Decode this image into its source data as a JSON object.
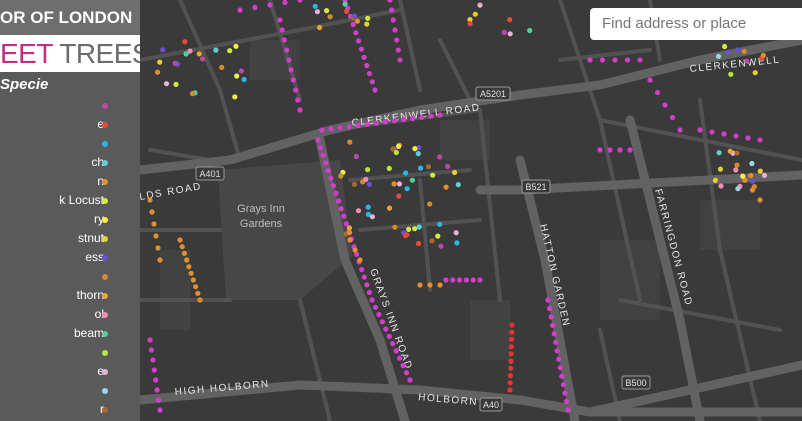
{
  "header": {
    "title": "OR OF LONDON",
    "subtitle_part1": "EET",
    "subtitle_part2": "TREES"
  },
  "legend": {
    "title": "Species",
    "items": [
      {
        "label": "",
        "color": "#b94aa6"
      },
      {
        "label": "e",
        "color": "#e54b35"
      },
      {
        "label": "",
        "color": "#2bb7e7"
      },
      {
        "label": "ch",
        "color": "#5ad1d6"
      },
      {
        "label": "n",
        "color": "#e38f2d"
      },
      {
        "label": "k Locust",
        "color": "#d6e93b"
      },
      {
        "label": "ry",
        "color": "#f4ee4a"
      },
      {
        "label": "stnut",
        "color": "#e8cd2f"
      },
      {
        "label": "ess",
        "color": "#6a4ed6"
      },
      {
        "label": "",
        "color": "#d48b2a"
      },
      {
        "label": "thorn",
        "color": "#e8a636"
      },
      {
        "label": "ol",
        "color": "#f48ab9"
      },
      {
        "label": "beam",
        "color": "#4fd19a"
      },
      {
        "label": "",
        "color": "#b6e63c"
      },
      {
        "label": "e",
        "color": "#e7b1dc"
      },
      {
        "label": "",
        "color": "#9ad8e6"
      },
      {
        "label": "r",
        "color": "#a86a2a"
      }
    ]
  },
  "search": {
    "placeholder": "Find address or place"
  },
  "map": {
    "roads": {
      "clerkenwell": "CLERKENWELL ROAD",
      "clerkenwell_e": "CLERKENWELL",
      "grays_inn": "GRAYS INN ROAD",
      "hatton": "HATTON GARDEN",
      "farringdon": "FARRINGDON ROAD",
      "high_holborn": "HIGH HOLBORN",
      "holborn": "HOLBORN",
      "theobalds": "LDS ROAD"
    },
    "park": {
      "line1": "Grays Inn",
      "line2": "Gardens"
    },
    "shields": {
      "a401": "A401",
      "a5201": "A5201",
      "b521": "B521",
      "b500": "B500",
      "a40": "A40"
    },
    "colors": {
      "background": "#3a3a3a",
      "road_major": "#5e5e5e",
      "road_minor": "#4f4f4f",
      "park": "#474747",
      "tree_magenta": "#d23ecb",
      "tree_orange": "#e38f2d",
      "tree_red": "#e5352f"
    }
  }
}
